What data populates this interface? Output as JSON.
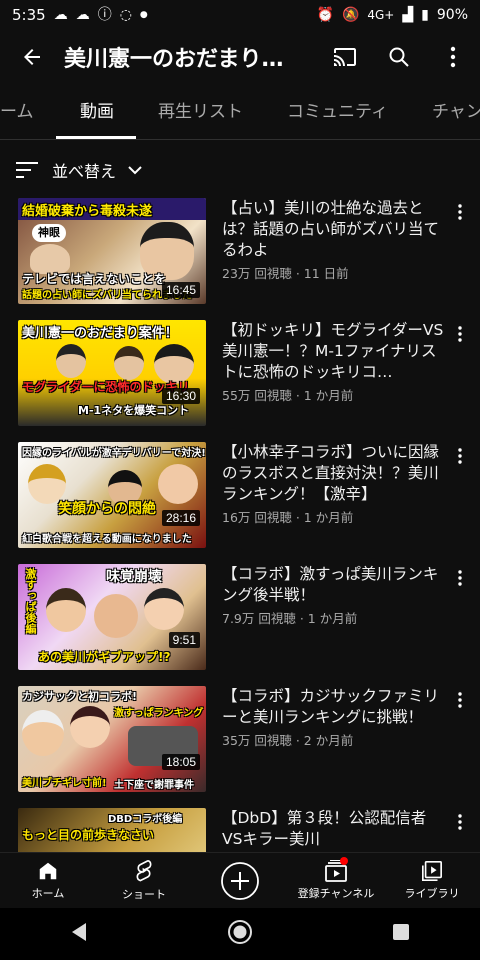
{
  "status": {
    "time": "5:35",
    "signal_text": "4G+",
    "battery": "90%"
  },
  "header": {
    "title": "美川憲一のおだまり…",
    "icons": [
      "back-arrow-icon",
      "cast-icon",
      "search-icon",
      "more-vert-icon"
    ]
  },
  "tabs": [
    {
      "label": "ーム"
    },
    {
      "label": "動画"
    },
    {
      "label": "再生リスト"
    },
    {
      "label": "コミュニティ"
    },
    {
      "label": "チャン"
    }
  ],
  "sort": {
    "label": "並べ替え"
  },
  "videos": [
    {
      "title": "【占い】美川の壮絶な過去とは？話題の占い師がズバリ当てるわよ",
      "meta": "23万 回視聴 · 11 日前",
      "duration": "16:45",
      "thumb_text_top": "結婚破棄から毒殺未遂",
      "thumb_text_bottom": "テレビでは言えないことを",
      "thumb_text_bottom2": "話題の占い師にズバリ当てられました",
      "thumb_tag": "神眼"
    },
    {
      "title": "【初ドッキリ】モグライダーVS美川憲一！？M-1ファイナリストに恐怖のドッキリコ…",
      "meta": "55万 回視聴 · 1 か月前",
      "duration": "16:30",
      "thumb_text_top": "美川憲一のおだまり案件！",
      "thumb_text_bottom": "モグライダーに恐怖のドッキリ",
      "thumb_text_bottom2": "M-1ネタを爆笑コント"
    },
    {
      "title": "【小林幸子コラボ】ついに因縁のラスボスと直接対決！？美川ランキング！【激辛】",
      "meta": "16万 回視聴 · 1 か月前",
      "duration": "28:16",
      "thumb_text_top": "因縁のライバルが激辛デリバリーで対決!",
      "thumb_text_bottom": "笑顔からの悶絶",
      "thumb_text_bottom2": "紅白歌合戦を超える動画になりました"
    },
    {
      "title": "【コラボ】激すっぱ美川ランキング後半戦！",
      "meta": "7.9万 回視聴 · 1 か月前",
      "duration": "9:51",
      "thumb_text_top": "味覚崩壊",
      "thumb_text_side": "激すっぱ後編",
      "thumb_text_bottom": "あの美川がギブアップ!?"
    },
    {
      "title": "【コラボ】カジサックファミリーと美川ランキングに挑戦！",
      "meta": "35万 回視聴 · 2 か月前",
      "duration": "18:05",
      "thumb_text_top": "カジサックと初コラボ!",
      "thumb_text_side": "激すっぱランキング",
      "thumb_text_bottom": "美川ブチギレ寸前!",
      "thumb_text_bottom2": "土下座で謝罪事件"
    },
    {
      "title": "【DbD】第３段！公認配信者VSキラー美川",
      "meta": "",
      "duration": "",
      "thumb_text_top": "DBDコラボ後編",
      "thumb_text_bottom": "もっと目の前歩きなさい"
    }
  ],
  "bottom_nav": [
    {
      "label": "ホーム",
      "icon": "home-icon"
    },
    {
      "label": "ショート",
      "icon": "shorts-icon"
    },
    {
      "label": "",
      "icon": "create-plus-icon"
    },
    {
      "label": "登録チャンネル",
      "icon": "subscriptions-icon"
    },
    {
      "label": "ライブラリ",
      "icon": "library-icon"
    }
  ],
  "colors": {
    "background": "#0f0f0f",
    "notification_dot": "#ff0000",
    "meta_text": "#aaaaaa"
  }
}
